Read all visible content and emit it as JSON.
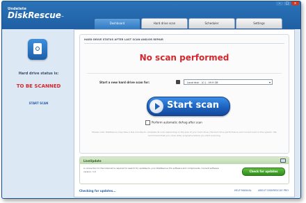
{
  "app": {
    "logo_small": "Undelete",
    "logo_big": "DiskRescue",
    "logo_tm": "™"
  },
  "window_controls": {
    "minimize": "–",
    "maximize": "□",
    "close": "x"
  },
  "tabs": [
    {
      "label": "Dashboard"
    },
    {
      "label": "Hard drive scan"
    },
    {
      "label": "Scheduler"
    },
    {
      "label": "Settings"
    }
  ],
  "sidebar": {
    "status_label": "Hard drive status is:",
    "status_value": "TO BE SCANNED",
    "link": "START SCAN"
  },
  "panel": {
    "title": "HARD DRIVE STATUS AFTER LAST SCAN AND/OR REPAIR",
    "result": "No scan performed",
    "start_label": "Start a new hard drive scan for:",
    "drive_value": "Local disk - (C:) - 49.9 GB",
    "start_button": "Start scan",
    "defrag_label": "Perform automatic defrag after scan",
    "note": "Please note: DiskRescue may take a few minutes to complete its scan depending on the size of your hard drive, the hard drive performance and current load on the system. We recommend that you close other programs before you start scanning."
  },
  "update": {
    "title": "LiveUpdate",
    "text": "A connection to the Internet is required to search for updates to your DiskRescue Pro software and components. Current software version: 1.0",
    "button": "Check for updates"
  },
  "status_bar": {
    "left": "Checking for updates...",
    "help": "HELP MANUAL",
    "about": "ABOUT DISKRESCUE PRO"
  }
}
